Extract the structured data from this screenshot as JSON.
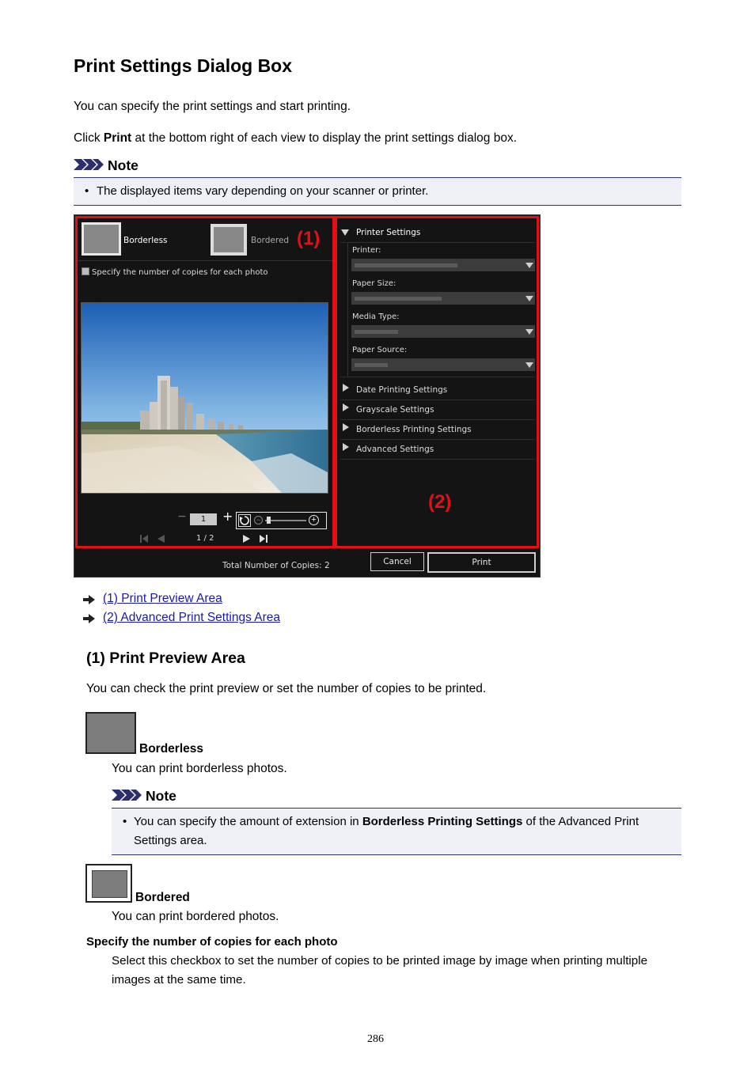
{
  "title": "Print Settings Dialog Box",
  "intro": "You can specify the print settings and start printing.",
  "click_pre": "Click ",
  "click_bold": "Print",
  "click_post": " at the bottom right of each view to display the print settings dialog box.",
  "note_label": "Note",
  "note1": "The displayed items vary depending on your scanner or printer.",
  "dialog": {
    "borderless_label": "Borderless",
    "bordered_label": "Bordered",
    "callout1": "(1)",
    "callout2": "(2)",
    "checkbox_label": "Specify the number of copies for each photo",
    "copies_value": "1",
    "page_indicator": "1 / 2",
    "printer_settings": "Printer Settings",
    "printer_label": "Printer:",
    "paper_size_label": "Paper Size:",
    "media_type_label": "Media Type:",
    "paper_source_label": "Paper Source:",
    "date_printing": "Date Printing Settings",
    "grayscale": "Grayscale Settings",
    "borderless_printing": "Borderless Printing Settings",
    "advanced": "Advanced Settings",
    "total_copies": "Total Number of Copies:  2",
    "cancel": "Cancel",
    "print": "Print"
  },
  "links": [
    "(1) Print Preview Area",
    "(2) Advanced Print Settings Area"
  ],
  "section1_title": "(1) Print Preview Area",
  "section1_intro": "You can check the print preview or set the number of copies to be printed.",
  "borderless_heading": "Borderless",
  "borderless_desc": "You can print borderless photos.",
  "note2_pre": "You can specify the amount of extension in ",
  "note2_bold": "Borderless Printing Settings",
  "note2_post": " of the Advanced Print",
  "note2_line2": "Settings area.",
  "bordered_heading": "Bordered",
  "bordered_desc": "You can print bordered photos.",
  "specify_heading": "Specify the number of copies for each photo",
  "specify_line1": "Select this checkbox to set the number of copies to be printed image by image when printing multiple",
  "specify_line2": "images at the same time.",
  "page_number": "286"
}
